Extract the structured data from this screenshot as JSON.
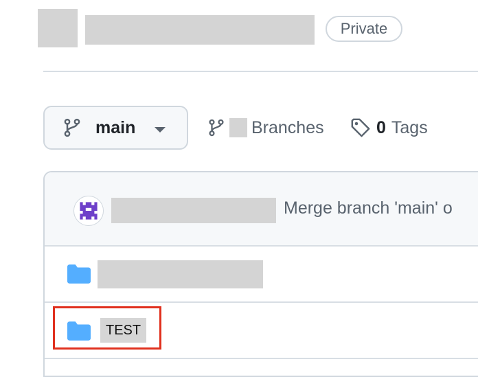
{
  "repo": {
    "visibility_badge": "Private"
  },
  "branch_selector": {
    "current_branch": "main"
  },
  "meta": {
    "branches_label": "Branches",
    "tags_count": "0",
    "tags_label": "Tags"
  },
  "latest_commit": {
    "message": "Merge branch 'main' o"
  },
  "files": [
    {
      "name": "TEST",
      "type": "folder",
      "highlighted": true
    }
  ],
  "colors": {
    "folder": "#54aeff",
    "highlight": "#e0301e",
    "avatar": "#6e40c9"
  },
  "icons": [
    "git-branch-icon",
    "chevron-down-icon",
    "tag-icon",
    "folder-icon",
    "avatar-identicon"
  ]
}
